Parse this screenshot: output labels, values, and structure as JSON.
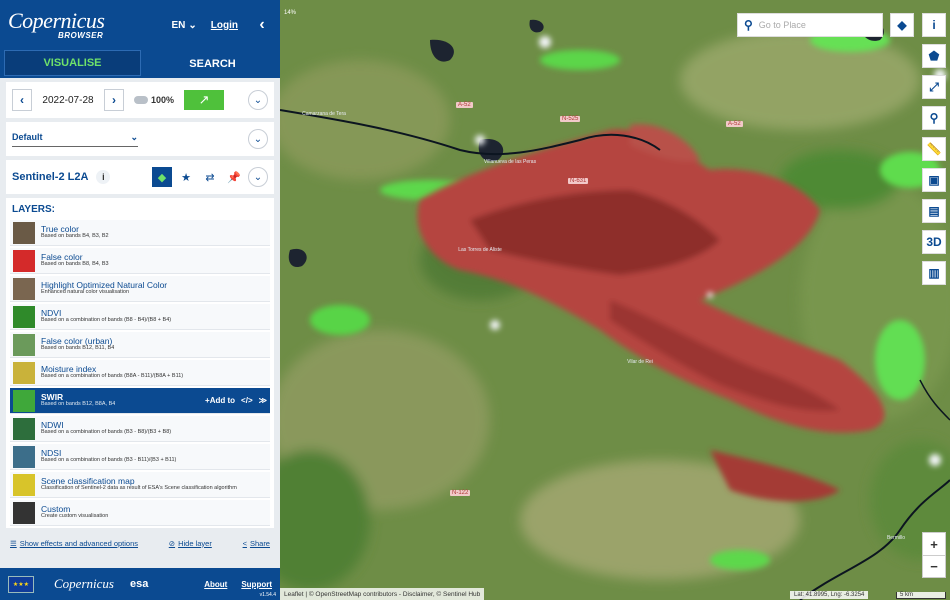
{
  "header": {
    "logo": "Copernicus",
    "logo_sub": "BROWSER",
    "language": "EN",
    "login": "Login"
  },
  "tabs": [
    {
      "label": "VISUALISE",
      "active": true
    },
    {
      "label": "SEARCH",
      "active": false
    }
  ],
  "date": {
    "value": "2022-07-28",
    "cloud_coverage": "100%"
  },
  "theme": {
    "selected": "Default"
  },
  "dataset": {
    "name": "Sentinel-2 L2A",
    "info": "i"
  },
  "layers": {
    "title": "LAYERS:",
    "items": [
      {
        "name": "True color",
        "desc": "Based on bands B4, B3, B2",
        "color": "#6a5a46"
      },
      {
        "name": "False color",
        "desc": "Based on bands B8, B4, B3",
        "color": "#d42a2a"
      },
      {
        "name": "Highlight Optimized Natural Color",
        "desc": "Enhanced natural color visualisation",
        "color": "#7a6650"
      },
      {
        "name": "NDVI",
        "desc": "Based on a combination of bands (B8 - B4)/(B8 + B4)",
        "color": "#2f8a2a"
      },
      {
        "name": "False color (urban)",
        "desc": "Based on bands B12, B11, B4",
        "color": "#6b9a5b"
      },
      {
        "name": "Moisture index",
        "desc": "Based on a combination of bands (B8A - B11)/(B8A + B11)",
        "color": "#c9b23a"
      },
      {
        "name": "SWIR",
        "desc": "Based on bands B12, B8A, B4",
        "color": "#3fa83a",
        "active": true
      },
      {
        "name": "NDWI",
        "desc": "Based on a combination of bands (B3 - B8)/(B3 + B8)",
        "color": "#2d6e3c"
      },
      {
        "name": "NDSI",
        "desc": "Based on a combination of bands (B3 - B11)/(B3 + B11)",
        "color": "#3c6e8a"
      },
      {
        "name": "Scene classification map",
        "desc": "Classification of Sentinel-2 data as result of ESA's Scene classification algorithm",
        "color": "#d8c42a"
      },
      {
        "name": "Custom",
        "desc": "Create custom visualisation",
        "color": "#333333"
      }
    ],
    "active_actions": {
      "add_to": "+Add to",
      "code": "</>",
      "expand": "≫"
    }
  },
  "options": {
    "effects": "Show effects and advanced options",
    "hide": "Hide layer",
    "share": "Share"
  },
  "footer": {
    "eu": "★★★",
    "copernicus": "Copernicus",
    "esa": "esa",
    "about": "About",
    "support": "Support",
    "version": "v1.54.4"
  },
  "map": {
    "zoom_level": "14%",
    "search_placeholder": "Go to Place",
    "roads": [
      "A-52",
      "N-525",
      "A-52",
      "N-631",
      "N-122"
    ],
    "towns": [
      "Camarzana de Tera",
      "Villanueva de las Peras",
      "Las Torres de Aliste",
      "Vilar de Rei",
      "Bermillo"
    ],
    "attribution": "Leaflet | © OpenStreetMap contributors - Disclaimer, © Sentinel Hub",
    "coords": "Lat: 41.8995, Lng: -6.3254",
    "scale": "5 km",
    "zoom_in": "+",
    "zoom_out": "−",
    "tools": [
      {
        "name": "info-icon",
        "glyph": "i",
        "blue": false
      },
      {
        "name": "aoi-icon",
        "glyph": "⬟",
        "blue": false
      },
      {
        "name": "measure-line-icon",
        "glyph": "⤢",
        "blue": false
      },
      {
        "name": "location-pin-icon",
        "glyph": "⚲",
        "blue": false
      },
      {
        "name": "ruler-icon",
        "glyph": "📏",
        "blue": false
      },
      {
        "name": "image-download-icon",
        "glyph": "▣",
        "blue": false
      },
      {
        "name": "timelapse-icon",
        "glyph": "▤",
        "blue": false
      },
      {
        "name": "3d-view-icon",
        "glyph": "3D",
        "blue": false
      },
      {
        "name": "histogram-icon",
        "glyph": "▥",
        "blue": false
      }
    ]
  }
}
